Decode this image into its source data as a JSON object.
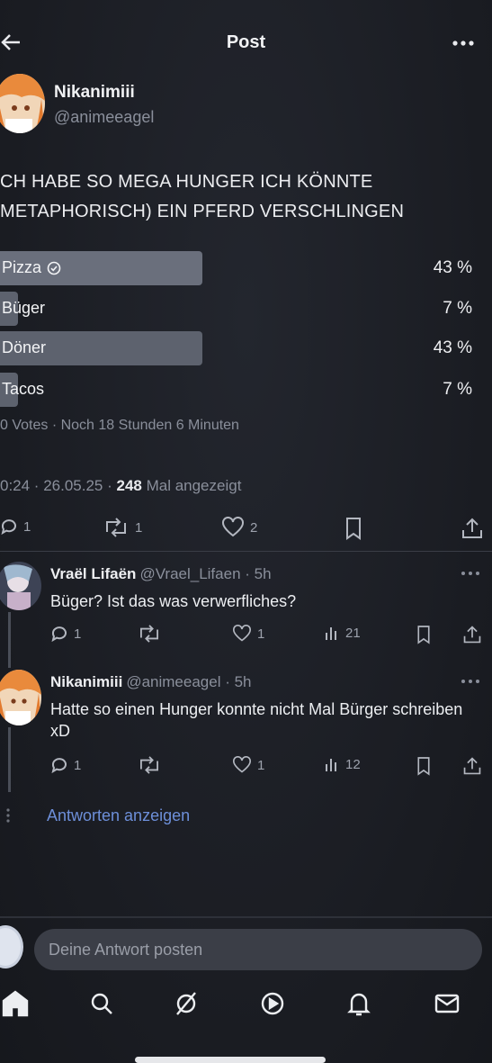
{
  "header": {
    "title": "Post"
  },
  "post": {
    "author_name": "Nikanimiii",
    "author_handle": "@animeeagel",
    "text": "CH HABE SO MEGA HUNGER ICH KÖNNTE\nMETAPHORISCH) EIN PFERD VERSCHLINGEN",
    "poll": {
      "options": [
        {
          "label": "Pizza",
          "percent": "43 %",
          "value": 43,
          "selected": true
        },
        {
          "label": "Büger",
          "percent": "7 %",
          "value": 7,
          "selected": false
        },
        {
          "label": "Döner",
          "percent": "43 %",
          "value": 43,
          "selected": false
        },
        {
          "label": "Tacos",
          "percent": "7 %",
          "value": 7,
          "selected": false
        }
      ],
      "meta": "0 Votes · Noch 18 Stunden 6 Minuten"
    },
    "timestamp_prefix": "0:24 · 26.05.25 · ",
    "views": "248",
    "views_suffix": " Mal angezeigt",
    "actions": {
      "replies": "1",
      "reposts": "1",
      "likes": "2"
    }
  },
  "replies": [
    {
      "name": "Vraël Lifaën",
      "handle": "@Vrael_Lifaen · 5h",
      "text": "Büger? Ist das was verwerfliches?",
      "replies": "1",
      "likes": "1",
      "views": "21"
    },
    {
      "name": "Nikanimiii",
      "handle": "@animeeagel · 5h",
      "text": "Hatte so einen Hunger konnte nicht Mal Bürger schreiben xD",
      "replies": "1",
      "likes": "1",
      "views": "12"
    }
  ],
  "show_replies": "Antworten anzeigen",
  "composer": {
    "placeholder": "Deine Antwort posten"
  },
  "nav": [
    "home-icon",
    "search-icon",
    "grok-icon",
    "video-icon",
    "notifications-icon",
    "messages-icon"
  ],
  "colors": {
    "background": "#1b1d24",
    "poll_bar": "#5d626e",
    "link": "#6d8fd9",
    "muted": "#8a8f9b"
  }
}
